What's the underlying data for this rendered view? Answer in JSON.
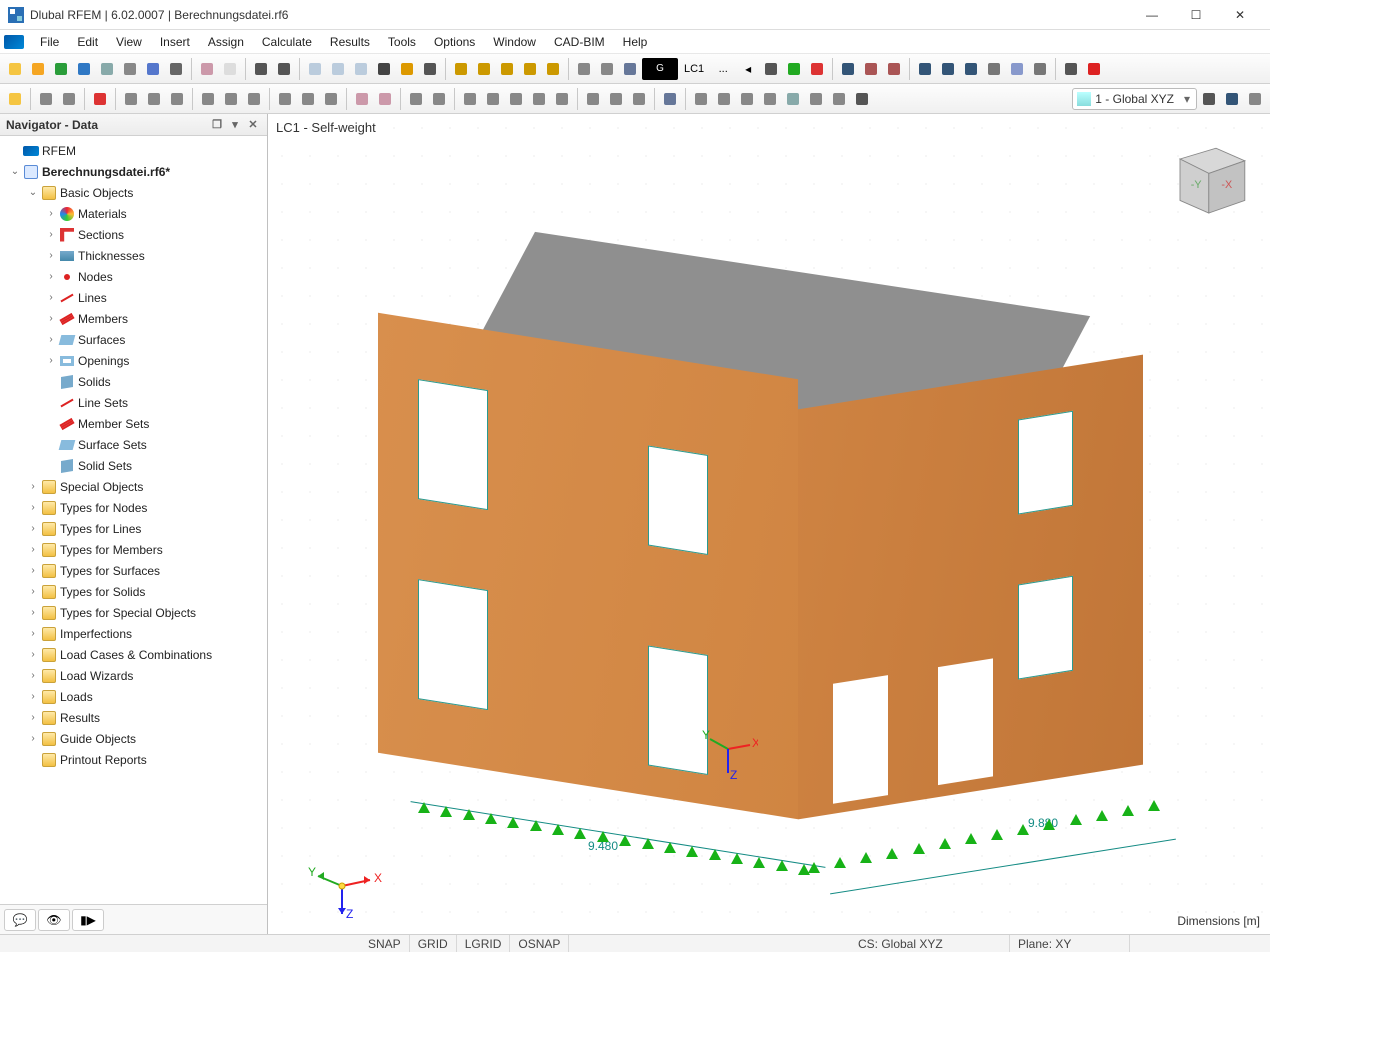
{
  "window": {
    "title": "Dlubal RFEM | 6.02.0007 | Berechnungsdatei.rf6"
  },
  "menu": [
    "File",
    "Edit",
    "View",
    "Insert",
    "Assign",
    "Calculate",
    "Results",
    "Tools",
    "Options",
    "Window",
    "CAD-BIM",
    "Help"
  ],
  "toolbar1_icons": [
    "new",
    "open",
    "refresh",
    "globe",
    "cube",
    "database",
    "save",
    "print",
    "/",
    "clipboard",
    "doc",
    "/",
    "undo",
    "redo",
    "/",
    "panel1",
    "panel2",
    "panel3",
    "console",
    "script",
    "more",
    "/",
    "lasso-sel",
    "sel-rect",
    "sel-circle",
    "sel-poly",
    "sel-window",
    "/",
    "align-left",
    "align-right",
    "fill"
  ],
  "lc": {
    "group": "G",
    "name": "LC1",
    "dots": "..."
  },
  "toolbar1_icons_right": [
    "prev",
    "play",
    "flag-del",
    "/",
    "anchor",
    "x-cross",
    "y-cross",
    "/",
    "eye",
    "xxx-box",
    "grid-snap",
    "eye-dash",
    "plane",
    "xxx",
    "/",
    "more",
    "close-red"
  ],
  "toolbar2_icons": [
    "star",
    "/",
    "star-v",
    "star-y",
    "/",
    "poly",
    "/",
    "pt-g",
    "pt-r",
    "pt-b",
    "/",
    "star-line",
    "star-dline",
    "vline",
    "/",
    "star-grid",
    "star-g",
    "star-b",
    "/",
    "box1",
    "box2",
    "/",
    "star-bl",
    "star-or",
    "/",
    "sel1",
    "sel2",
    "sel3",
    "sel4",
    "sel5",
    "/",
    "solid1",
    "solid2",
    "tube",
    "/",
    "filter",
    "/",
    "frame1",
    "frame2",
    "wave",
    "dash",
    "cube",
    "gear",
    "chev",
    "more"
  ],
  "global_dropdown": "1 - Global XYZ",
  "navigator": {
    "title": "Navigator - Data",
    "root": "RFEM",
    "file": "Berechnungsdatei.rf6*",
    "tree": [
      {
        "l": 1,
        "type": "root",
        "label": "RFEM"
      },
      {
        "l": 1,
        "type": "file",
        "label": "Berechnungsdatei.rf6*",
        "exp": true
      },
      {
        "l": 2,
        "type": "folder",
        "label": "Basic Objects",
        "exp": true
      },
      {
        "l": 3,
        "type": "mat",
        "label": "Materials",
        "chev": true
      },
      {
        "l": 3,
        "type": "sec",
        "label": "Sections",
        "chev": true
      },
      {
        "l": 3,
        "type": "thk",
        "label": "Thicknesses",
        "chev": true
      },
      {
        "l": 3,
        "type": "node",
        "label": "Nodes",
        "chev": true
      },
      {
        "l": 3,
        "type": "line",
        "label": "Lines",
        "chev": true
      },
      {
        "l": 3,
        "type": "mem",
        "label": "Members",
        "chev": true
      },
      {
        "l": 3,
        "type": "surf",
        "label": "Surfaces",
        "chev": true
      },
      {
        "l": 3,
        "type": "open",
        "label": "Openings",
        "chev": true
      },
      {
        "l": 3,
        "type": "solid",
        "label": "Solids"
      },
      {
        "l": 3,
        "type": "line",
        "label": "Line Sets"
      },
      {
        "l": 3,
        "type": "mem",
        "label": "Member Sets"
      },
      {
        "l": 3,
        "type": "surf",
        "label": "Surface Sets"
      },
      {
        "l": 3,
        "type": "solid",
        "label": "Solid Sets"
      },
      {
        "l": 2,
        "type": "folder",
        "label": "Special Objects",
        "chev": true
      },
      {
        "l": 2,
        "type": "folder",
        "label": "Types for Nodes",
        "chev": true
      },
      {
        "l": 2,
        "type": "folder",
        "label": "Types for Lines",
        "chev": true
      },
      {
        "l": 2,
        "type": "folder",
        "label": "Types for Members",
        "chev": true
      },
      {
        "l": 2,
        "type": "folder",
        "label": "Types for Surfaces",
        "chev": true
      },
      {
        "l": 2,
        "type": "folder",
        "label": "Types for Solids",
        "chev": true
      },
      {
        "l": 2,
        "type": "folder",
        "label": "Types for Special Objects",
        "chev": true
      },
      {
        "l": 2,
        "type": "folder",
        "label": "Imperfections",
        "chev": true
      },
      {
        "l": 2,
        "type": "folder",
        "label": "Load Cases & Combinations",
        "chev": true
      },
      {
        "l": 2,
        "type": "folder",
        "label": "Load Wizards",
        "chev": true
      },
      {
        "l": 2,
        "type": "folder",
        "label": "Loads",
        "chev": true
      },
      {
        "l": 2,
        "type": "folder",
        "label": "Results",
        "chev": true
      },
      {
        "l": 2,
        "type": "folder",
        "label": "Guide Objects",
        "chev": true
      },
      {
        "l": 2,
        "type": "folder",
        "label": "Printout Reports"
      }
    ]
  },
  "viewport": {
    "label": "LC1 - Self-weight",
    "dim_left": "9.480",
    "dim_right": "9.880",
    "axes": {
      "x": "X",
      "y": "Y",
      "z": "Z",
      "nx": "-X",
      "ny": "-Y"
    },
    "units_label": "Dimensions [m]"
  },
  "status": {
    "snap": "SNAP",
    "grid": "GRID",
    "lgrid": "LGRID",
    "osnap": "OSNAP",
    "cs": "CS: Global XYZ",
    "plane": "Plane: XY"
  }
}
